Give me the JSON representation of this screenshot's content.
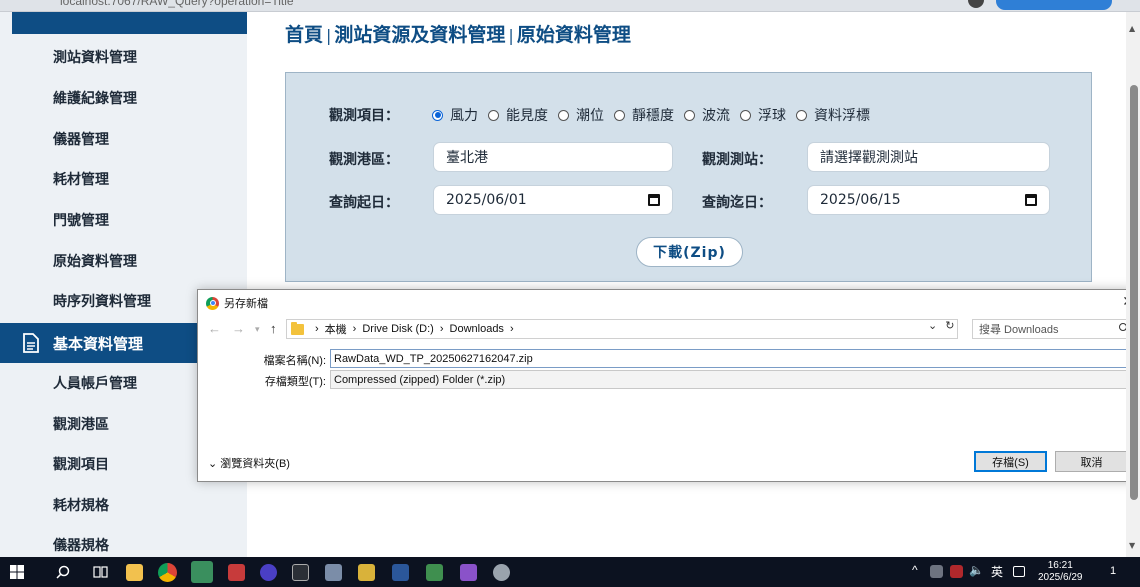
{
  "browser": {
    "url": "localhost:7067/RAW_Query?operation=Title"
  },
  "sidebar": {
    "items": [
      {
        "label": "測站資料管理"
      },
      {
        "label": "維護紀錄管理"
      },
      {
        "label": "儀器管理"
      },
      {
        "label": "耗材管理"
      },
      {
        "label": "門號管理"
      },
      {
        "label": "原始資料管理"
      },
      {
        "label": "時序列資料管理"
      }
    ],
    "section_label": "基本資料管理",
    "sub_items": [
      {
        "label": "人員帳戶管理"
      },
      {
        "label": "觀測港區"
      },
      {
        "label": "觀測項目"
      },
      {
        "label": "耗材規格"
      },
      {
        "label": "儀器規格"
      }
    ]
  },
  "breadcrumb": {
    "home": "首頁",
    "level1": "測站資源及資料管理",
    "level2": "原始資料管理",
    "separator": "|"
  },
  "query": {
    "item_label": "觀測項目：",
    "options": [
      {
        "label": "風力",
        "checked": true
      },
      {
        "label": "能見度",
        "checked": false
      },
      {
        "label": "潮位",
        "checked": false
      },
      {
        "label": "靜穩度",
        "checked": false
      },
      {
        "label": "波流",
        "checked": false
      },
      {
        "label": "浮球",
        "checked": false
      },
      {
        "label": "資料浮標",
        "checked": false
      }
    ],
    "port_label": "觀測港區：",
    "port_value": "臺北港",
    "station_label": "觀測測站：",
    "station_placeholder": "請選擇觀測測站",
    "start_label": "查詢起日：",
    "start_value": "2025/06/01",
    "end_label": "查詢迄日：",
    "end_value": "2025/06/15",
    "download_label": "下載(Zip)"
  },
  "dialog": {
    "title": "另存新檔",
    "path": [
      "本機",
      "Drive Disk (D:)",
      "Downloads"
    ],
    "search_placeholder": "搜尋 Downloads",
    "filename_label": "檔案名稱(N):",
    "filename_value": "RawData_WD_TP_20250627162047.zip",
    "filetype_label": "存檔類型(T):",
    "filetype_value": "Compressed (zipped) Folder (*.zip)",
    "browse_label": "瀏覽資料夾(B)",
    "save_label": "存檔(S)",
    "cancel_label": "取消"
  },
  "taskbar": {
    "ime": "英",
    "time": "16:21",
    "date": "2025/6/29",
    "notification_count": "1"
  },
  "colors": {
    "brand": "#0e4d84",
    "panel": "#d3e0ea",
    "sidebar": "#edf1f5",
    "accent": "#0a64d8"
  }
}
